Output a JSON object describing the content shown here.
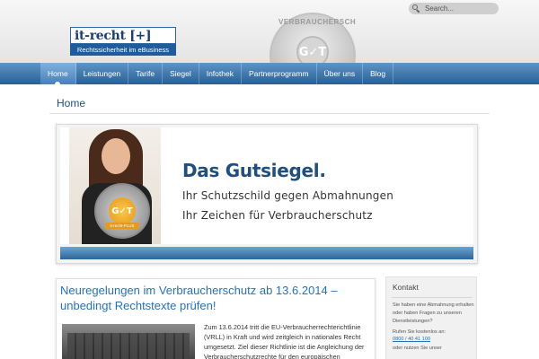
{
  "header": {
    "logo": {
      "name": "it-recht [+]",
      "tagline": "Rechtssicherheit im eBusiness"
    },
    "seal": {
      "text": "VERBRAUCHERSCHUTZ",
      "mark": "G✓T"
    },
    "search": {
      "placeholder": "Search..."
    }
  },
  "nav": {
    "items": [
      {
        "label": "Home"
      },
      {
        "label": "Leistungen"
      },
      {
        "label": "Tarife"
      },
      {
        "label": "Siegel"
      },
      {
        "label": "Infothek"
      },
      {
        "label": "Partnerprogramm"
      },
      {
        "label": "Über uns"
      },
      {
        "label": "Blog"
      }
    ],
    "active": "Home"
  },
  "page": {
    "title": "Home"
  },
  "banner": {
    "headline": "Das Gutsiegel.",
    "line1": "Ihr Schutzschild gegen Abmahnungen",
    "line2": "Ihr Zeichen für Verbraucherschutz",
    "badge_mark": "G✓T",
    "badge_plus": "it-recht-PLUS"
  },
  "article": {
    "title": "Neuregelungen im Verbraucherschutz ab 13.6.2014 – unbedingt Rechtstexte prüfen!",
    "text": "Zum 13.6.2014 tritt die EU-Verbraucherrechterichtlinie (VRLL) in Kraft und wird zeitgleich in nationales Recht umgesetzt. Ziel dieser Richtlinie ist die Angleichung der Verbraucherschutzrechte für den europäischen"
  },
  "sidebar": {
    "title": "Kontakt",
    "text1": "Sie haben eine Abmahnung erhalten oder haben Fragen zu unseren Dienstleistungen?",
    "text2": "Rufen Sie kostenlos an:",
    "phone": "0800 / 40 41 100",
    "text3": "oder nutzen Sie unser"
  }
}
